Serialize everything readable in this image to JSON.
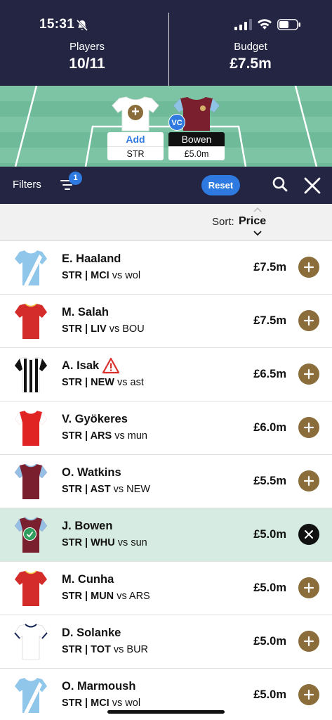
{
  "status_bar": {
    "time": "15:31",
    "icons": [
      "bell-slash-icon",
      "signal-icon",
      "wifi-icon",
      "battery-icon"
    ]
  },
  "header": {
    "players_label": "Players",
    "players_value": "10/11",
    "budget_label": "Budget",
    "budget_value": "£7.5m"
  },
  "pitch": {
    "slot_add": {
      "name": "Add",
      "position": "STR"
    },
    "slot_bowen": {
      "badge": "VC",
      "name": "Bowen",
      "price": "£5.0m"
    }
  },
  "filterbar": {
    "filters_label": "Filters",
    "filter_count": "1",
    "reset_label": "Reset"
  },
  "sortbar": {
    "label": "Sort:",
    "value": "Price"
  },
  "colors": {
    "navy": "#242543",
    "accent_blue": "#2e7ae0",
    "gold_action": "#8a6d3b",
    "selected_row": "#d6ebe1",
    "pitch_green": "#7cc4a3"
  },
  "players": [
    {
      "name": "E. Haaland",
      "pos": "STR",
      "team": "MCI",
      "opp": "vs wol",
      "price": "£7.5m",
      "selected": false,
      "kit": "light-blue-sash"
    },
    {
      "name": "M. Salah",
      "pos": "STR",
      "team": "LIV",
      "opp": "vs BOU",
      "price": "£7.5m",
      "selected": false,
      "kit": "red"
    },
    {
      "name": "A. Isak",
      "pos": "STR",
      "team": "NEW",
      "opp": "vs ast",
      "price": "£6.5m",
      "selected": false,
      "kit": "black-white-stripes",
      "warning": true
    },
    {
      "name": "V. Gyökeres",
      "pos": "STR",
      "team": "ARS",
      "opp": "vs mun",
      "price": "£6.0m",
      "selected": false,
      "kit": "red-white-sleeves"
    },
    {
      "name": "O. Watkins",
      "pos": "STR",
      "team": "AST",
      "opp": "vs NEW",
      "price": "£5.5m",
      "selected": false,
      "kit": "claret-blue"
    },
    {
      "name": "J. Bowen",
      "pos": "STR",
      "team": "WHU",
      "opp": "vs sun",
      "price": "£5.0m",
      "selected": true,
      "kit": "claret-blue"
    },
    {
      "name": "M. Cunha",
      "pos": "STR",
      "team": "MUN",
      "opp": "vs ARS",
      "price": "£5.0m",
      "selected": false,
      "kit": "red"
    },
    {
      "name": "D. Solanke",
      "pos": "STR",
      "team": "TOT",
      "opp": "vs BUR",
      "price": "£5.0m",
      "selected": false,
      "kit": "white-navy"
    },
    {
      "name": "O. Marmoush",
      "pos": "STR",
      "team": "MCI",
      "opp": "vs wol",
      "price": "£5.0m",
      "selected": false,
      "kit": "light-blue-sash"
    }
  ]
}
